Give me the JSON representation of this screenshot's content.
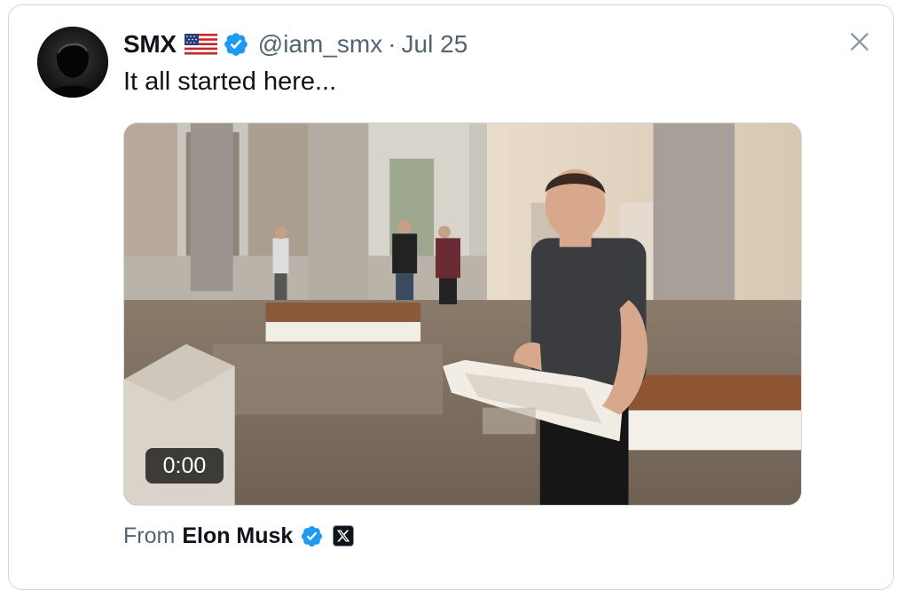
{
  "tweet": {
    "author_name": "SMX",
    "author_handle": "@iam_smx",
    "separator": "·",
    "date": "Jul 25",
    "text": "It all started here...",
    "flag_icon": "us-flag-icon",
    "verified_color": "#1d9bf0"
  },
  "media": {
    "timestamp": "0:00"
  },
  "attribution": {
    "label": "From",
    "name": "Elon Musk"
  },
  "colors": {
    "text": "#0f1419",
    "secondary": "#536471",
    "border": "#cfd9de",
    "verified": "#1d9bf0"
  }
}
